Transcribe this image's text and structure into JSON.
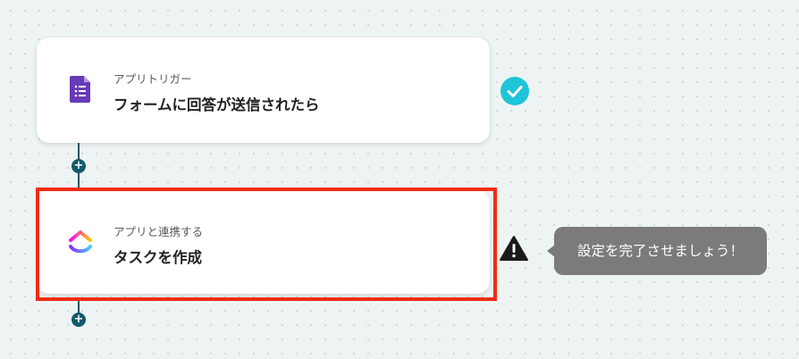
{
  "flow": {
    "trigger": {
      "subtitle": "アプリトリガー",
      "title": "フォームに回答が送信されたら",
      "icon": "google-forms-icon",
      "status_icon": "check-icon",
      "status_color": "#1ec4d8"
    },
    "action": {
      "subtitle": "アプリと連携する",
      "title": "タスクを作成",
      "icon": "clickup-icon",
      "status_icon": "warning-icon",
      "highlight_color": "#f22b13"
    },
    "add_step_label": "+",
    "tooltip": "設定を完了させましょう！"
  },
  "colors": {
    "connector": "#0f5a6b",
    "tooltip_bg": "#7b7b7b",
    "canvas_bg": "#eef3f3"
  }
}
